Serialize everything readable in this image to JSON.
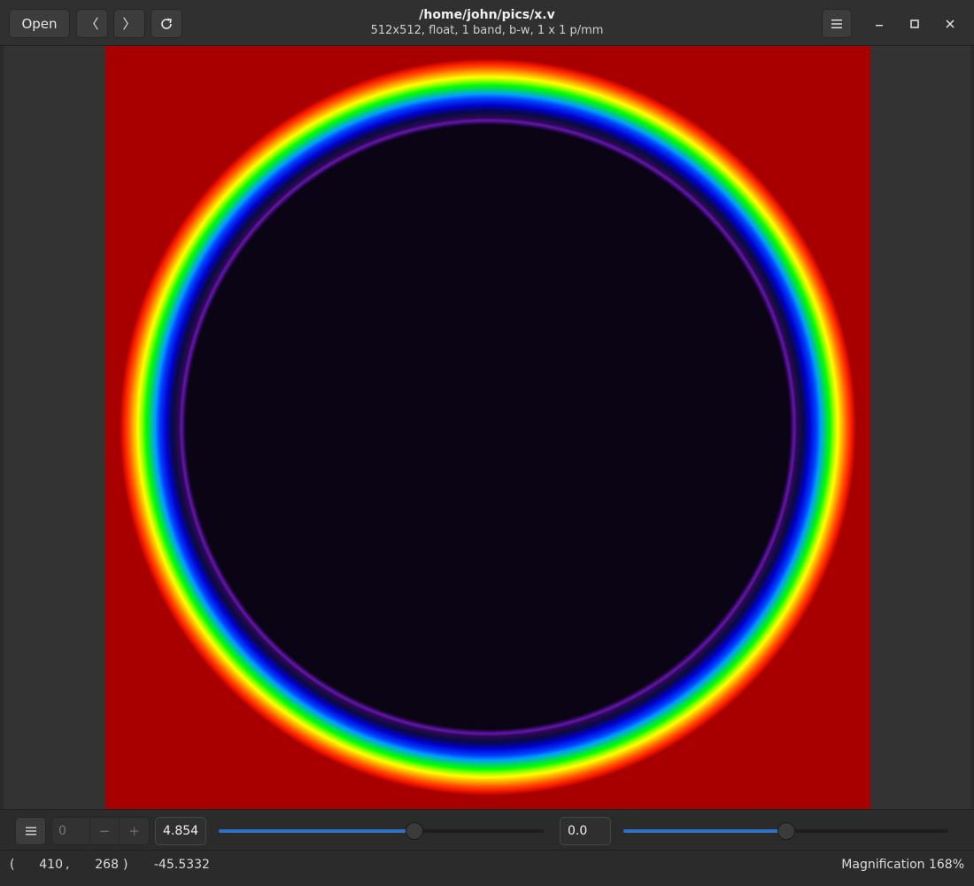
{
  "header": {
    "open_label": "Open",
    "back_glyph": "〈",
    "forward_glyph": "〉",
    "title": "/home/john/pics/x.v",
    "subtitle": "512x512,  float, 1 band, b-w, 1 x 1 p/mm",
    "icons": [
      "back-icon",
      "forward-icon",
      "reload-icon",
      "hamburger-menu-icon",
      "minimize-icon",
      "maximize-icon",
      "close-icon"
    ]
  },
  "image": {
    "colors": {
      "background": "#a80000",
      "center": "#0b0415"
    }
  },
  "controls": {
    "page_value": "0",
    "minus_label": "−",
    "plus_label": "+",
    "scale_value": "4.854",
    "scale_slider_fraction": 0.6,
    "offset_value": "0.0",
    "offset_slider_fraction": 0.5,
    "accent_color": "#2f6fc4"
  },
  "status": {
    "open_paren": "(",
    "x": "410",
    "comma": ",",
    "y": "268",
    "close_paren": ")",
    "pixel_value": "-45.5332",
    "magnification": "Magnification 168%"
  }
}
